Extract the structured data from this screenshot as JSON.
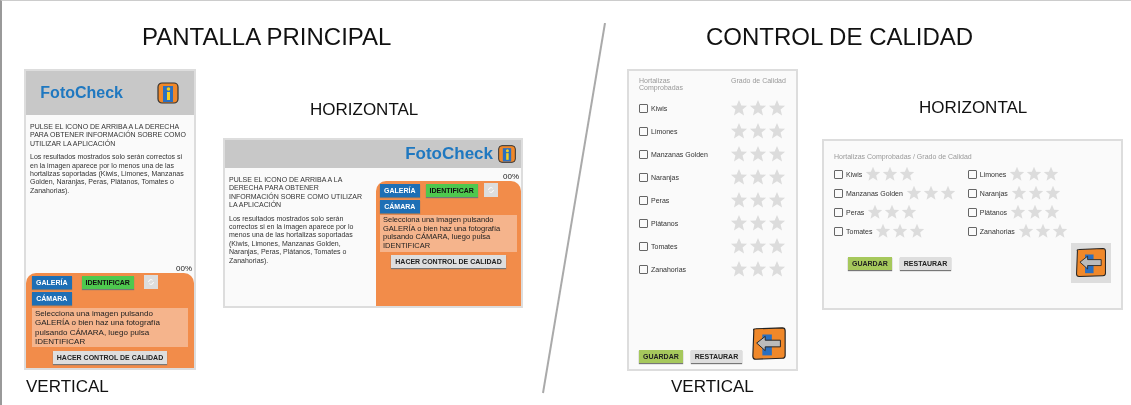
{
  "main": {
    "title": "PANTALLA PRINCIPAL",
    "screens": [
      {
        "kind": "vertical",
        "caption": "VERTICAL",
        "app_title": "FotoCheck",
        "instructions": "PULSE EL ICONO DE ARRIBA A LA DERECHA PARA OBTENER INFORMACIÓN SOBRE COMO UTILIZAR LA APLICACIÓN",
        "disclaimer": "Los resultados mostrados solo serán correctos si en la imagen aparece por lo menos una de las hortalizas soportadas (Kiwis, Limones, Manzanas Golden, Naranjas, Peras, Plátanos, Tomates o Zanahorias).",
        "percent": "00%",
        "gallery_button": "GALERÍA",
        "camera_button": "CÁMARA",
        "identify_button": "IDENTIFICAR",
        "message": "Selecciona una imagen pulsando GALERÍA o bien haz una fotografía pulsando CÁMARA, luego pulsa IDENTIFICAR",
        "quality_button": "HACER CONTROL DE CALIDAD"
      },
      {
        "kind": "horizontal",
        "caption": "HORIZONTAL",
        "app_title": "FotoCheck",
        "instructions": "PULSE EL ICONO DE ARRIBA A LA DERECHA PARA OBTENER INFORMACIÓN SOBRE COMO UTILIZAR LA APLICACIÓN",
        "disclaimer": "Los resultados mostrados solo serán correctos si en la imagen aparece por lo menos una de las hortalizas soportadas (Kiwis, Limones, Manzanas Golden, Naranjas, Peras, Plátanos, Tomates o Zanahorias).",
        "percent": "00%",
        "gallery_button": "GALERÍA",
        "camera_button": "CÁMARA",
        "identify_button": "IDENTIFICAR",
        "message": "Selecciona una imagen pulsando GALERÍA o bien haz una fotografía pulsando CÁMARA, luego pulsa IDENTIFICAR",
        "quality_button": "HACER CONTROL DE CALIDAD"
      }
    ]
  },
  "quality": {
    "title": "CONTROL DE CALIDAD",
    "screens": [
      {
        "kind": "vertical",
        "caption": "VERTICAL",
        "headers": [
          "Hortalizas Comprobadas",
          "Grado de Calidad"
        ],
        "items": [
          {
            "name": "Kiwis",
            "checked": false,
            "stars": 0
          },
          {
            "name": "Limones",
            "checked": false,
            "stars": 0
          },
          {
            "name": "Manzanas Golden",
            "checked": false,
            "stars": 0
          },
          {
            "name": "Naranjas",
            "checked": false,
            "stars": 0
          },
          {
            "name": "Peras",
            "checked": false,
            "stars": 0
          },
          {
            "name": "Plátanos",
            "checked": false,
            "stars": 0
          },
          {
            "name": "Tomates",
            "checked": false,
            "stars": 0
          },
          {
            "name": "Zanahorias",
            "checked": false,
            "stars": 0
          }
        ],
        "save_button": "GUARDAR",
        "reset_button": "RESTAURAR"
      },
      {
        "kind": "horizontal",
        "caption": "HORIZONTAL",
        "headers": [
          "Hortalizas Comprobadas / Grado de Calidad"
        ],
        "items": [
          {
            "name": "Kiwis",
            "checked": false,
            "stars": 0
          },
          {
            "name": "Limones",
            "checked": false,
            "stars": 0
          },
          {
            "name": "Manzanas Golden",
            "checked": false,
            "stars": 0
          },
          {
            "name": "Naranjas",
            "checked": false,
            "stars": 0
          },
          {
            "name": "Peras",
            "checked": false,
            "stars": 0
          },
          {
            "name": "Plátanos",
            "checked": false,
            "stars": 0
          },
          {
            "name": "Tomates",
            "checked": false,
            "stars": 0
          },
          {
            "name": "Zanahorias",
            "checked": false,
            "stars": 0
          }
        ],
        "save_button": "GUARDAR",
        "reset_button": "RESTAURAR"
      }
    ]
  }
}
